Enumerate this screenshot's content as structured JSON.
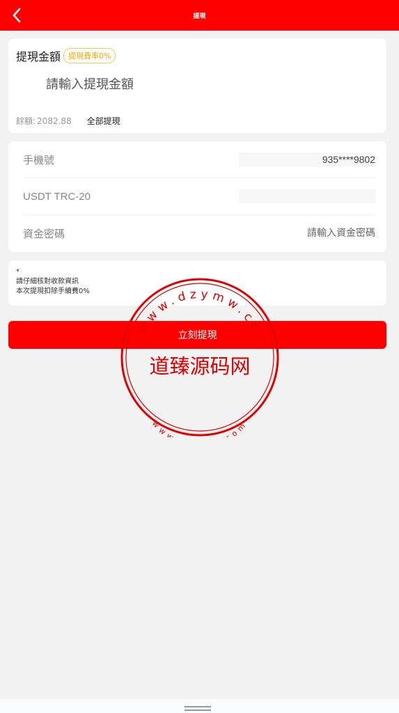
{
  "header": {
    "title": "提現",
    "back_icon": "chevron-left-icon"
  },
  "amount_card": {
    "title": "提現金額",
    "fee_badge": "提現費率0%",
    "amount_placeholder": "請輸入提現金額",
    "balance_label": "餘額:",
    "balance_value": "2082.88",
    "withdraw_all_label": "全部提現"
  },
  "form": {
    "phone_label": "手機號",
    "phone_value": "935****9802",
    "usdt_label": "USDT TRC-20",
    "usdt_value": "",
    "password_label": "資金密碼",
    "password_placeholder": "請輸入資金密碼"
  },
  "notice": {
    "star": "*",
    "line1": "請仔細核對收款資訊",
    "line2": "本次提現扣除手續費0%"
  },
  "submit_label": "立刻提現",
  "watermark": {
    "center_text": "道臻源码网",
    "ring_top": "www.dzymw.cc",
    "ring_bottom": "www.dzymw.com"
  },
  "colors": {
    "brand": "#ff0000",
    "badge": "#e6a817",
    "background": "#f2f2f2"
  }
}
